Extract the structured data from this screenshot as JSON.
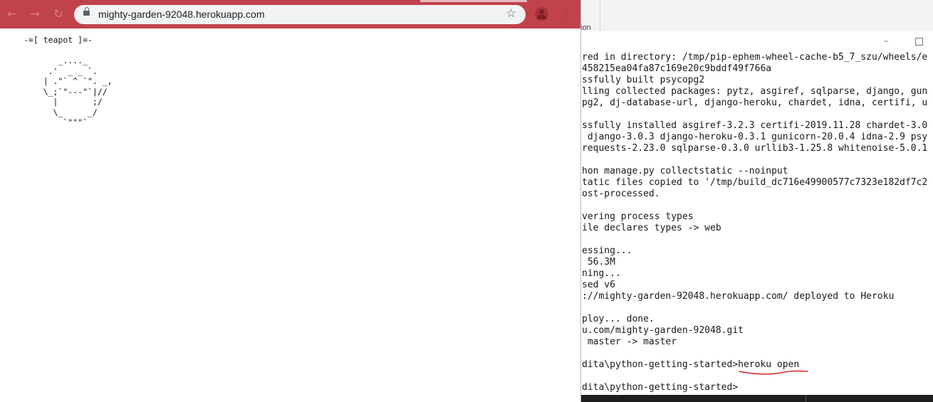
{
  "background_window": {
    "fragment_text": "ion"
  },
  "browser": {
    "url": "mighty-garden-92048.herokuapp.com",
    "icons": {
      "back": "arrow-left-icon",
      "forward": "arrow-right-icon",
      "reload": "reload-icon",
      "lock": "lock-icon",
      "bookmark": "star-icon",
      "profile": "profile-icon",
      "menu": "kebab-menu-icon"
    },
    "page": {
      "heading": "-=[ teapot ]=-",
      "ascii_art": "       _...._\n     .'  _ _ `.\n    | .\"` ^ `\". _,\n    \\_;`\"---\"`|//\n      |       ;/\n      \\_     _/\n        `\"\"\"`"
    }
  },
  "terminal": {
    "lines": [
      "red in directory: /tmp/pip-ephem-wheel-cache-b5_7_szu/wheels/e",
      "458215ea04fa87c169e20c9bddf49f766a",
      "ssfully built psycopg2",
      "lling collected packages: pytz, asgiref, sqlparse, django, gun",
      "pg2, dj-database-url, django-heroku, chardet, idna, certifi, u",
      "",
      "ssfully installed asgiref-3.2.3 certifi-2019.11.28 chardet-3.0",
      " django-3.0.3 django-heroku-0.3.1 gunicorn-20.0.4 idna-2.9 psy",
      "requests-2.23.0 sqlparse-0.3.0 urllib3-1.25.8 whitenoise-5.0.1",
      "",
      "hon manage.py collectstatic --noinput",
      "tatic files copied to '/tmp/build_dc716e49900577c7323e182df7c2",
      "ost-processed.",
      "",
      "vering process types",
      "ile declares types -> web",
      "",
      "essing...",
      " 56.3M",
      "ning...",
      "sed v6",
      "://mighty-garden-92048.herokuapp.com/ deployed to Heroku",
      "",
      "ploy... done.",
      "u.com/mighty-garden-92048.git",
      " master -> master",
      "",
      "dita\\python-getting-started>heroku open",
      "",
      "dita\\python-getting-started>"
    ],
    "window_controls": {
      "minimize": "minimize-icon",
      "maximize": "maximize-icon"
    },
    "annotation_color": "#d9262c"
  },
  "colors": {
    "browser_toolbar": "#c0424b",
    "omnibox": "#f1f3f4"
  }
}
